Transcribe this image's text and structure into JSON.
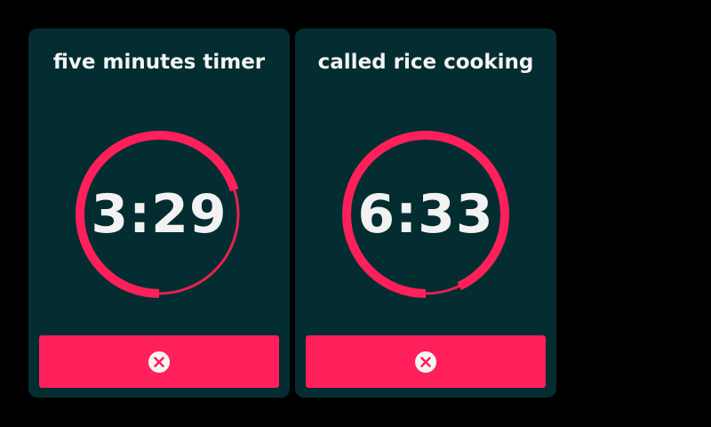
{
  "timers": [
    {
      "title": "five minutes timer",
      "remaining": "3:29",
      "progress_remaining": 0.7,
      "cancel_icon": "close-circle-icon"
    },
    {
      "title": "called rice cooking",
      "remaining": "6:33",
      "progress_remaining": 0.93,
      "cancel_icon": "close-circle-icon"
    }
  ],
  "colors": {
    "background": "#000000",
    "card": "#042d31",
    "accent": "#ff1f5a",
    "ring_track": "#e6214f",
    "text": "#f2f2f2"
  }
}
